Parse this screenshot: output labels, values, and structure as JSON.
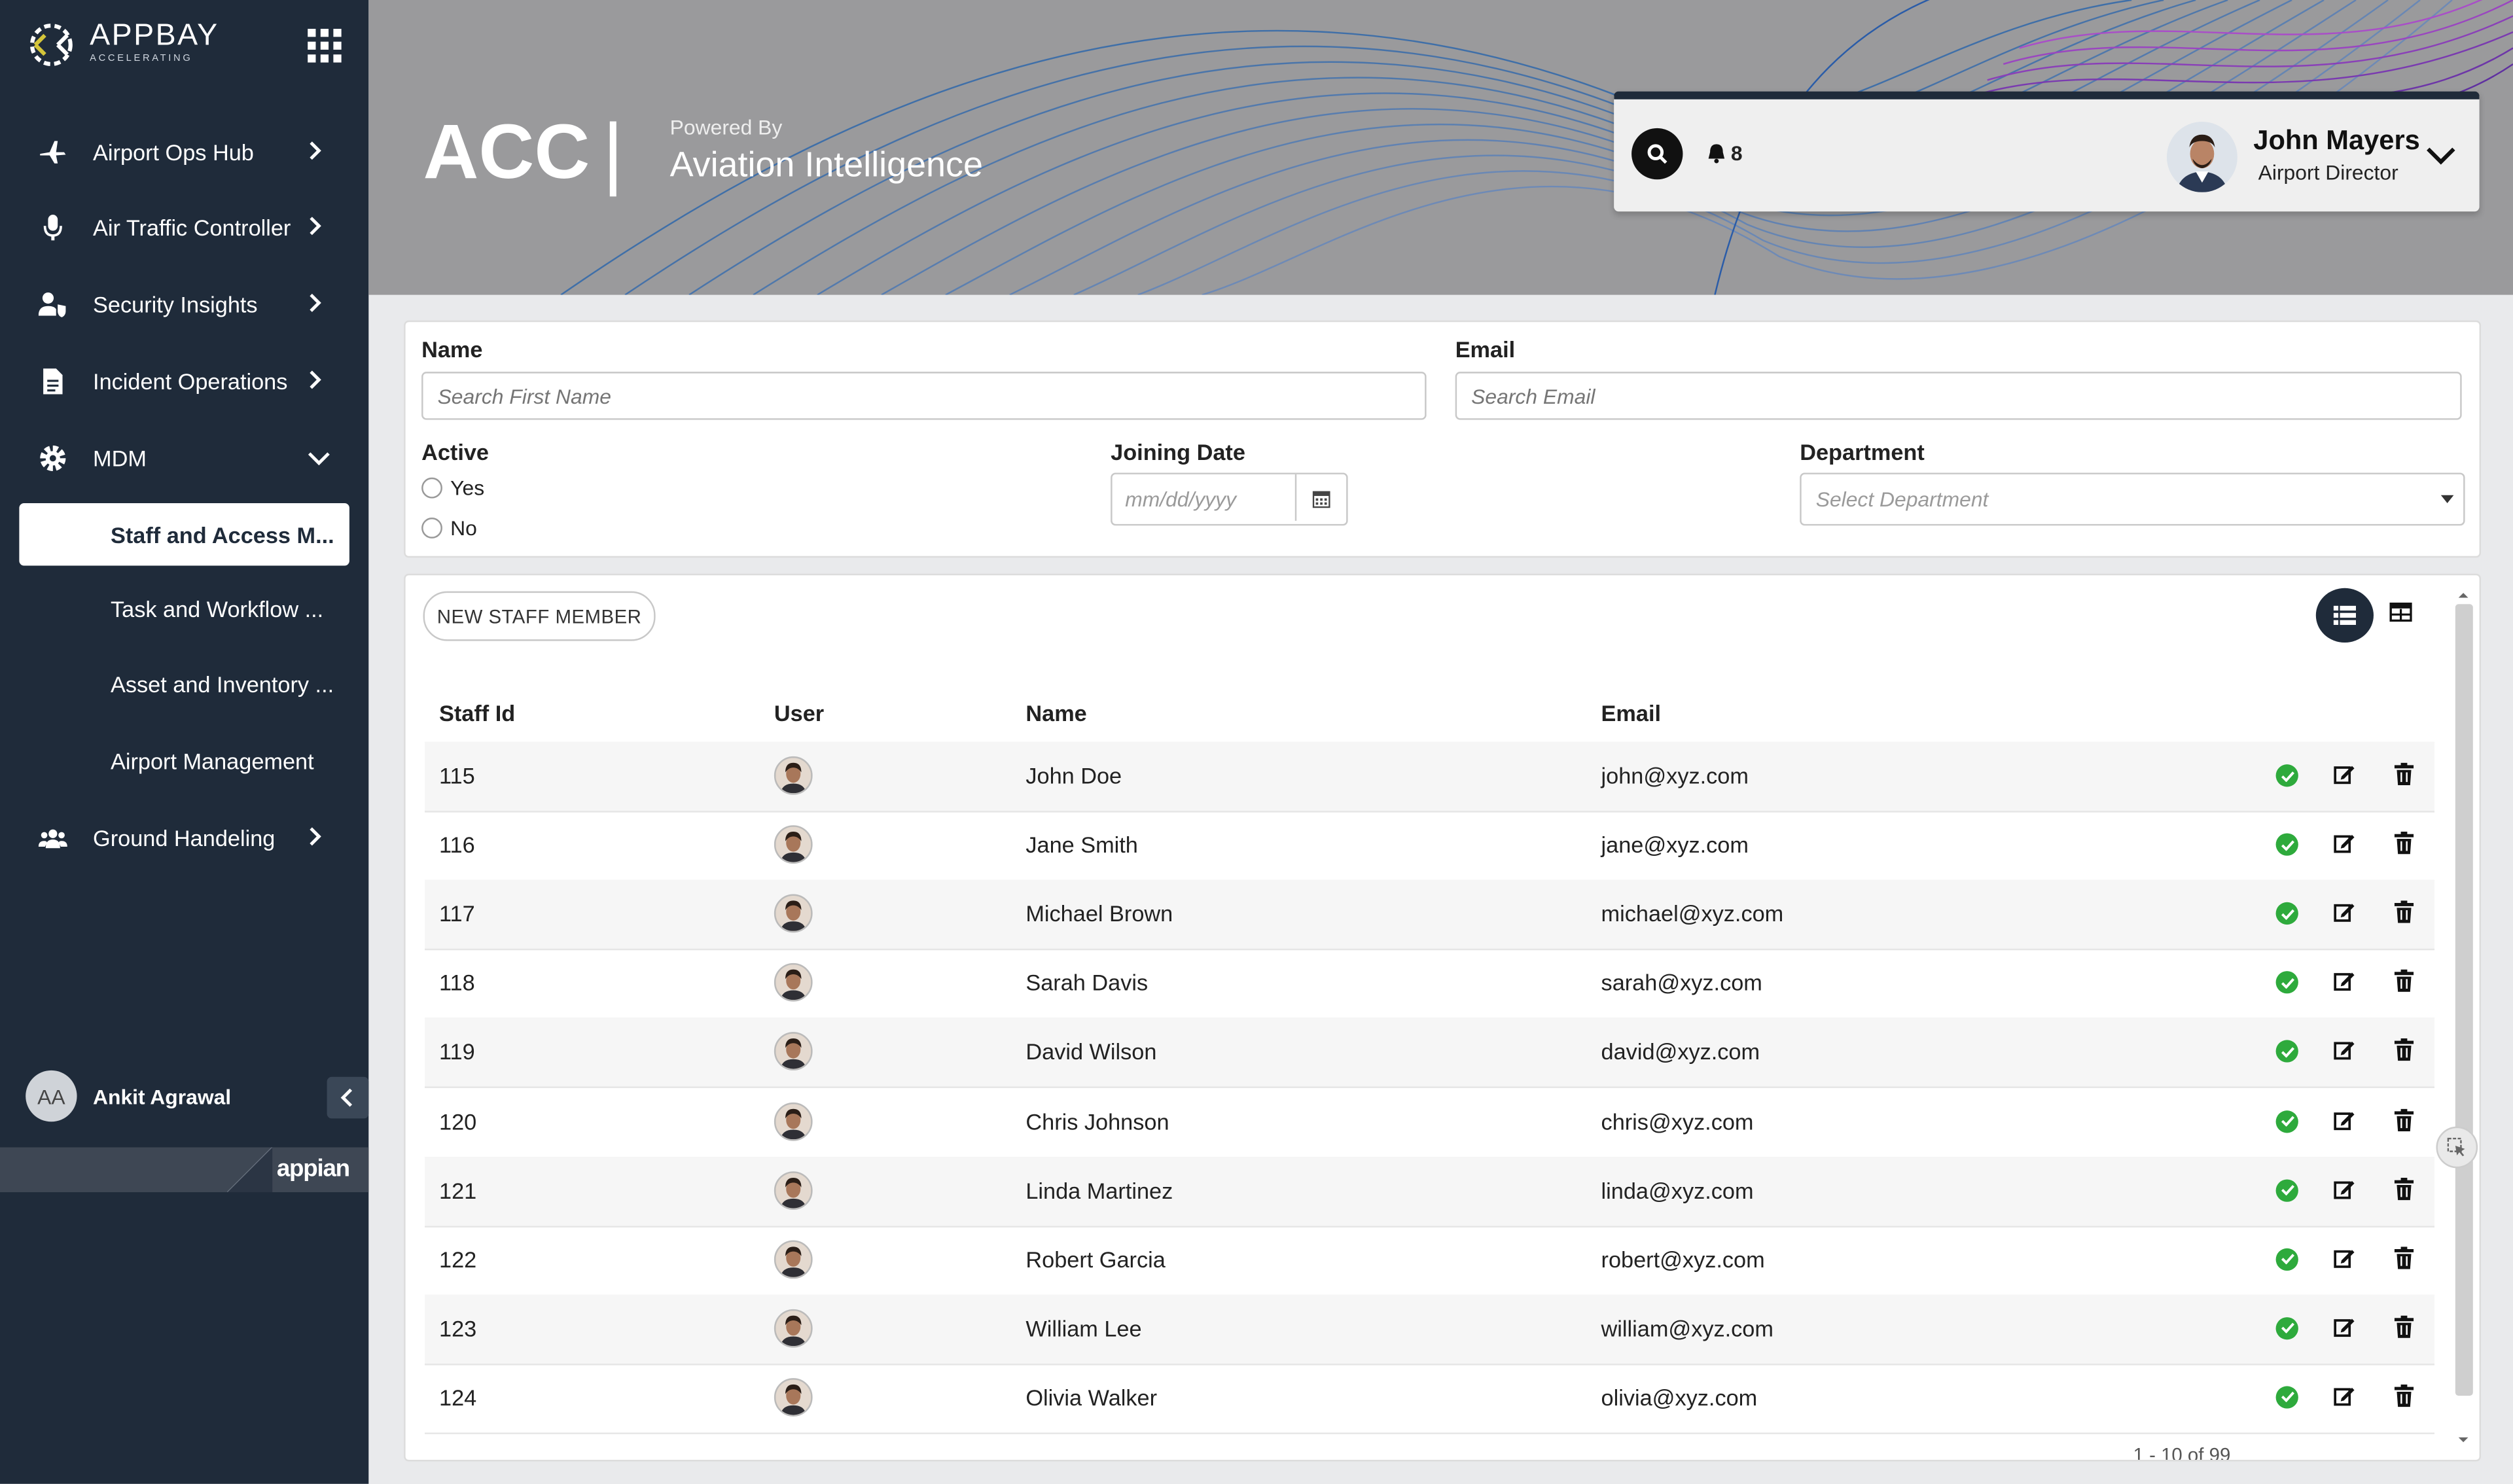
{
  "brand": {
    "name": "APPBAY",
    "tagline": "ACCELERATING"
  },
  "sidebar": {
    "items": [
      {
        "label": "Airport Ops Hub",
        "icon": "plane-icon"
      },
      {
        "label": "Air Traffic Controller",
        "icon": "microphone-icon"
      },
      {
        "label": "Security Insights",
        "icon": "user-shield-icon"
      },
      {
        "label": "Incident Operations",
        "icon": "document-icon"
      },
      {
        "label": "MDM",
        "icon": "gear-icon"
      },
      {
        "label": "Ground Handeling",
        "icon": "users-icon"
      }
    ],
    "sub_items": [
      "Staff and Access M...",
      "Task and Workflow ...",
      "Asset and Inventory ...",
      "Airport Management"
    ],
    "user": {
      "initials": "AA",
      "name": "Ankit Agrawal"
    },
    "footer_brand": "appian"
  },
  "header": {
    "title": "ACC",
    "separator": "|",
    "powered_by": "Powered By",
    "product": "Aviation Intelligence",
    "notifications": "8",
    "profile": {
      "name": "John Mayers",
      "role": "Airport Director"
    }
  },
  "filters": {
    "name_label": "Name",
    "name_placeholder": "Search First Name",
    "email_label": "Email",
    "email_placeholder": "Search Email",
    "active_label": "Active",
    "active_yes": "Yes",
    "active_no": "No",
    "joining_label": "Joining Date",
    "joining_placeholder": "mm/dd/yyyy",
    "department_label": "Department",
    "department_placeholder": "Select Department"
  },
  "table": {
    "new_button": "NEW STAFF MEMBER",
    "columns": [
      "Staff Id",
      "User",
      "Name",
      "Email"
    ],
    "rows": [
      {
        "id": "115",
        "name": "John Doe",
        "email": "john@xyz.com"
      },
      {
        "id": "116",
        "name": "Jane Smith",
        "email": "jane@xyz.com"
      },
      {
        "id": "117",
        "name": "Michael Brown",
        "email": "michael@xyz.com"
      },
      {
        "id": "118",
        "name": "Sarah Davis",
        "email": "sarah@xyz.com"
      },
      {
        "id": "119",
        "name": "David Wilson",
        "email": "david@xyz.com"
      },
      {
        "id": "120",
        "name": "Chris Johnson",
        "email": "chris@xyz.com"
      },
      {
        "id": "121",
        "name": "Linda Martinez",
        "email": "linda@xyz.com"
      },
      {
        "id": "122",
        "name": "Robert Garcia",
        "email": "robert@xyz.com"
      },
      {
        "id": "123",
        "name": "William Lee",
        "email": "william@xyz.com"
      },
      {
        "id": "124",
        "name": "Olivia Walker",
        "email": "olivia@xyz.com"
      }
    ],
    "pager": "1 - 10 of 99"
  },
  "colors": {
    "sidebar": "#1f2b3a",
    "header": "#9a9a9c",
    "success": "#2eaa3c"
  }
}
